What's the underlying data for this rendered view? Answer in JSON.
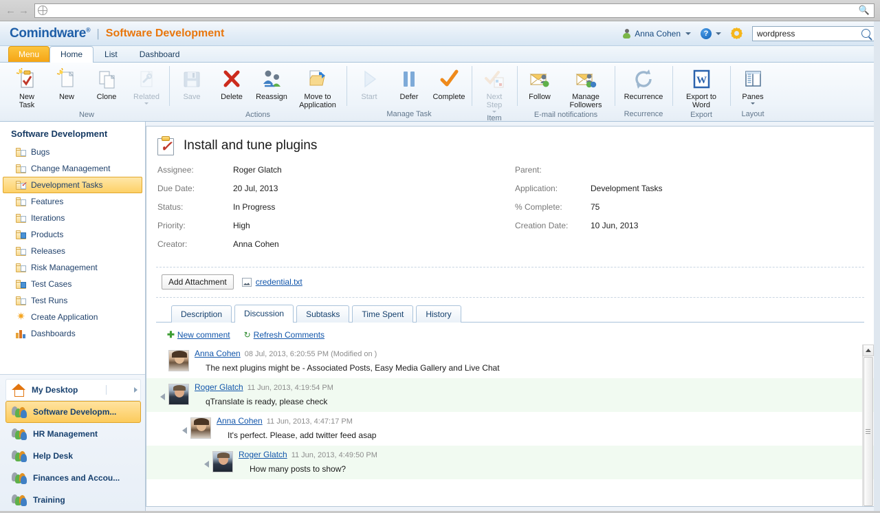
{
  "browser": {
    "back_icon": "back-arrow-icon",
    "forward_icon": "forward-arrow-icon",
    "url_value": "",
    "url_placeholder": ""
  },
  "header": {
    "logo": "Comindware",
    "logo_tm": "®",
    "separator": "|",
    "app_title": "Software Development",
    "user_name": "Anna Cohen",
    "help_label": "?",
    "search_value": "wordpress",
    "search_placeholder": "Search"
  },
  "tabstrip": {
    "tabs": [
      {
        "label": "Menu",
        "kind": "menu"
      },
      {
        "label": "Home",
        "kind": "active"
      },
      {
        "label": "List",
        "kind": "normal"
      },
      {
        "label": "Dashboard",
        "kind": "normal"
      }
    ]
  },
  "ribbon": {
    "groups": [
      {
        "name": "New",
        "buttons": [
          {
            "label": "New\nTask",
            "line1": "New",
            "line2": "Task",
            "icon": "new-task-icon",
            "disabled": false,
            "dropdown": false
          },
          {
            "label": "New",
            "line1": "New",
            "line2": "",
            "icon": "new-icon",
            "disabled": false,
            "dropdown": false
          },
          {
            "label": "Clone",
            "line1": "Clone",
            "line2": "",
            "icon": "clone-icon",
            "disabled": false,
            "dropdown": false
          },
          {
            "label": "Related",
            "line1": "Related",
            "line2": "",
            "icon": "related-icon",
            "disabled": true,
            "dropdown": true
          }
        ]
      },
      {
        "name": "Actions",
        "buttons": [
          {
            "label": "Save",
            "line1": "Save",
            "line2": "",
            "icon": "save-icon",
            "disabled": true,
            "dropdown": false
          },
          {
            "label": "Delete",
            "line1": "Delete",
            "line2": "",
            "icon": "delete-icon",
            "disabled": false,
            "dropdown": false
          },
          {
            "label": "Reassign",
            "line1": "Reassign",
            "line2": "",
            "icon": "reassign-icon",
            "disabled": false,
            "dropdown": false
          },
          {
            "label": "Move to Application",
            "line1": "Move to",
            "line2": "Application",
            "icon": "move-to-application-icon",
            "disabled": false,
            "dropdown": false
          }
        ]
      },
      {
        "name": "Manage Task",
        "buttons": [
          {
            "label": "Start",
            "line1": "Start",
            "line2": "",
            "icon": "start-icon",
            "disabled": true,
            "dropdown": false
          },
          {
            "label": "Defer",
            "line1": "Defer",
            "line2": "",
            "icon": "defer-icon",
            "disabled": false,
            "dropdown": false
          },
          {
            "label": "Complete",
            "line1": "Complete",
            "line2": "",
            "icon": "complete-icon",
            "disabled": false,
            "dropdown": false
          }
        ]
      },
      {
        "name": "Item",
        "buttons": [
          {
            "label": "Next Step",
            "line1": "Next",
            "line2": "Step",
            "icon": "next-step-icon",
            "disabled": true,
            "dropdown": true
          }
        ]
      },
      {
        "name": "E-mail notifications",
        "buttons": [
          {
            "label": "Follow",
            "line1": "Follow",
            "line2": "",
            "icon": "follow-icon",
            "disabled": false,
            "dropdown": false
          },
          {
            "label": "Manage Followers",
            "line1": "Manage",
            "line2": "Followers",
            "icon": "manage-followers-icon",
            "disabled": false,
            "dropdown": false
          }
        ]
      },
      {
        "name": "Recurrence",
        "buttons": [
          {
            "label": "Recurrence",
            "line1": "Recurrence",
            "line2": "",
            "icon": "recurrence-icon",
            "disabled": false,
            "dropdown": false
          }
        ]
      },
      {
        "name": "Export",
        "buttons": [
          {
            "label": "Export to Word",
            "line1": "Export to",
            "line2": "Word",
            "icon": "export-to-word-icon",
            "disabled": false,
            "dropdown": false
          }
        ]
      },
      {
        "name": "Layout",
        "buttons": [
          {
            "label": "Panes",
            "line1": "Panes",
            "line2": "",
            "icon": "panes-icon",
            "disabled": false,
            "dropdown": true
          }
        ]
      }
    ]
  },
  "sidebar": {
    "title": "Software Development",
    "items": [
      {
        "label": "Bugs",
        "icon": "folder-icon",
        "selected": false
      },
      {
        "label": "Change Management",
        "icon": "folder-icon",
        "selected": false
      },
      {
        "label": "Development Tasks",
        "icon": "folder-task-icon",
        "selected": true
      },
      {
        "label": "Features",
        "icon": "folder-icon",
        "selected": false
      },
      {
        "label": "Iterations",
        "icon": "folder-icon",
        "selected": false
      },
      {
        "label": "Products",
        "icon": "folder-blue-icon",
        "selected": false
      },
      {
        "label": "Releases",
        "icon": "folder-icon",
        "selected": false
      },
      {
        "label": "Risk Management",
        "icon": "folder-icon",
        "selected": false
      },
      {
        "label": "Test Cases",
        "icon": "folder-blue-icon",
        "selected": false
      },
      {
        "label": "Test Runs",
        "icon": "folder-icon",
        "selected": false
      },
      {
        "label": "Create Application",
        "icon": "star-icon",
        "selected": false
      },
      {
        "label": "Dashboards",
        "icon": "chart-bars-icon",
        "selected": false
      }
    ],
    "apps": [
      {
        "label": "My Desktop",
        "icon": "home-icon",
        "style": "white",
        "has_expander": true
      },
      {
        "label": "Software Developm...",
        "icon": "people-icon",
        "style": "selected",
        "has_expander": false
      },
      {
        "label": "HR Management",
        "icon": "people-icon",
        "style": "plain",
        "has_expander": false
      },
      {
        "label": "Help Desk",
        "icon": "people-icon",
        "style": "plain",
        "has_expander": false
      },
      {
        "label": "Finances and Accou...",
        "icon": "people-icon",
        "style": "plain",
        "has_expander": false
      },
      {
        "label": "Training",
        "icon": "people-icon",
        "style": "plain",
        "has_expander": false
      }
    ]
  },
  "task": {
    "title": "Install and tune plugins",
    "icon": "task-clipboard-icon",
    "fields_left": [
      {
        "label": "Assignee:",
        "value": "Roger Glatch"
      },
      {
        "label": "Due Date:",
        "value": "20 Jul, 2013"
      },
      {
        "label": "Status:",
        "value": "In Progress"
      },
      {
        "label": "Priority:",
        "value": "High"
      },
      {
        "label": "Creator:",
        "value": "Anna Cohen"
      }
    ],
    "fields_right": [
      {
        "label": "Parent:",
        "value": ""
      },
      {
        "label": "Application:",
        "value": "Development Tasks"
      },
      {
        "label": "% Complete:",
        "value": "75"
      },
      {
        "label": "Creation Date:",
        "value": "10 Jun, 2013"
      }
    ],
    "add_attachment_label": "Add Attachment",
    "attachments": [
      {
        "name": "credential.txt",
        "icon": "file-icon"
      }
    ],
    "tabs": [
      {
        "label": "Description",
        "active": false
      },
      {
        "label": "Discussion",
        "active": true
      },
      {
        "label": "Subtasks",
        "active": false
      },
      {
        "label": "Time Spent",
        "active": false
      },
      {
        "label": "History",
        "active": false
      }
    ]
  },
  "discussion": {
    "new_comment_label": "New comment",
    "refresh_label": "Refresh Comments",
    "comments": [
      {
        "author": "Anna Cohen",
        "meta": "08 Jul, 2013, 6:20:55 PM (Modified on )",
        "text": "The next plugins might be - Associated Posts, Easy Media Gallery and Live Chat",
        "indent": 0,
        "avatar": "anna",
        "highlight": false,
        "collapse_arrow": false
      },
      {
        "author": "Roger Glatch",
        "meta": "11 Jun, 2013, 4:19:54 PM",
        "text": "qTranslate is ready, please check",
        "indent": 0,
        "avatar": "roger",
        "highlight": true,
        "collapse_arrow": true
      },
      {
        "author": "Anna Cohen",
        "meta": "11 Jun, 2013, 4:47:17 PM",
        "text": "It's perfect. Please, add twitter feed asap",
        "indent": 1,
        "avatar": "anna",
        "highlight": false,
        "collapse_arrow": true
      },
      {
        "author": "Roger Glatch",
        "meta": "11 Jun, 2013, 4:49:50 PM",
        "text": "How many posts to show?",
        "indent": 2,
        "avatar": "roger",
        "highlight": true,
        "collapse_arrow": true
      }
    ]
  },
  "colors": {
    "brand_blue": "#1f5fa8",
    "brand_orange": "#e8760c",
    "selection_gold": "#fdd066",
    "link_blue": "#1155aa",
    "highlight_green": "#f1faf1"
  }
}
